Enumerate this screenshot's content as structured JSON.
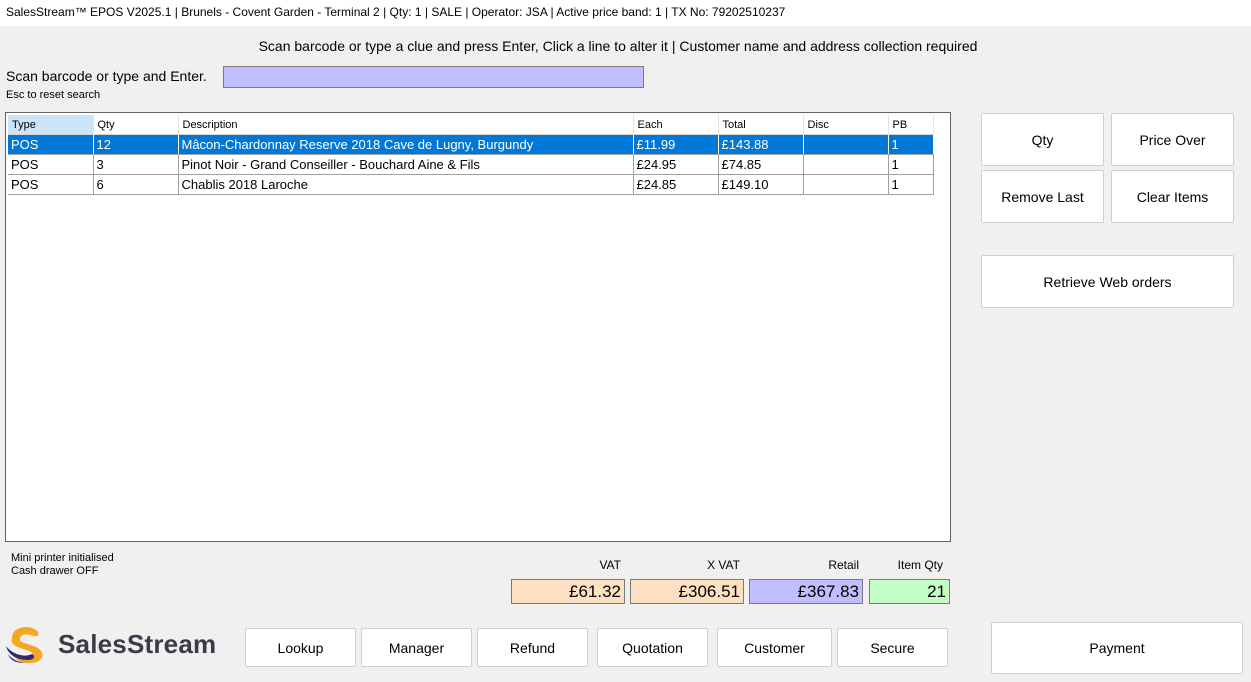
{
  "title_bar": "SalesStream™ EPOS V2025.1 | Brunels - Covent Garden - Terminal 2 | Qty: 1 | SALE | Operator: JSA | Active price band: 1 | TX No: 79202510237",
  "instruction": "Scan barcode or type a clue and press Enter, Click a line to alter it | Customer name and address collection required",
  "scan": {
    "label": "Scan barcode or type and Enter.",
    "value": "",
    "hint": "Esc to reset search"
  },
  "grid": {
    "columns": [
      "Type",
      "Qty",
      "Description",
      "Each",
      "Total",
      "Disc",
      "PB"
    ],
    "rows": [
      [
        "POS",
        "12",
        "Mâcon-Chardonnay Reserve 2018 Cave de Lugny, Burgundy",
        "£11.99",
        "£143.88",
        "",
        "1"
      ],
      [
        "POS",
        "3",
        "Pinot Noir - Grand Conseiller - Bouchard Aine & Fils",
        "£24.95",
        "£74.85",
        "",
        "1"
      ],
      [
        "POS",
        "6",
        "Chablis 2018 Laroche",
        "£24.85",
        "£149.10",
        "",
        "1"
      ]
    ]
  },
  "side_buttons": {
    "qty": "Qty",
    "price_over": "Price Over",
    "remove_last": "Remove Last",
    "clear_items": "Clear Items",
    "retrieve_web_orders": "Retrieve Web orders"
  },
  "status": {
    "line1": "Mini printer initialised",
    "line2": "Cash drawer OFF"
  },
  "totals": {
    "vat_label": "VAT",
    "vat": "£61.32",
    "xvat_label": "X VAT",
    "xvat": "£306.51",
    "retail_label": "Retail",
    "retail": "£367.83",
    "itemqty_label": "Item Qty",
    "itemqty": "21",
    "colors": {
      "vat": "#fde0c2",
      "xvat": "#fde0c2",
      "retail": "#bfbfff",
      "itemqty": "#c4fcc4"
    }
  },
  "bottom_buttons": {
    "lookup": "Lookup",
    "manager": "Manager",
    "refund": "Refund",
    "quotation": "Quotation",
    "customer": "Customer",
    "secure": "Secure",
    "payment": "Payment"
  },
  "logo": {
    "text": "SalesStream",
    "icon": "salesstream-s-logo-icon",
    "colors": [
      "#f5a623",
      "#2e2a6e"
    ]
  }
}
